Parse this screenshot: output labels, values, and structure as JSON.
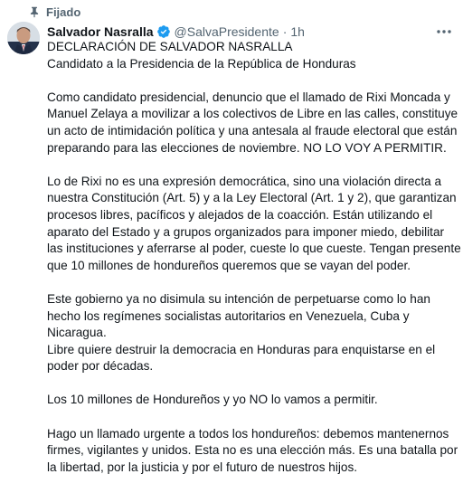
{
  "pinned": {
    "label": "Fijado",
    "icon": "pin-icon"
  },
  "author": {
    "display_name": "Salvador Nasralla",
    "handle": "@SalvaPresidente",
    "separator": "·",
    "time": "1h",
    "verified_icon": "verified-badge-icon",
    "verified_color": "#1d9bf0"
  },
  "more_icon": "more-horizontal-icon",
  "body": {
    "title_lines": [
      "DECLARACIÓN DE SALVADOR NASRALLA",
      "Candidato a la Presidencia de la República de Honduras"
    ],
    "paragraph1": [
      "Como candidato presidencial, denuncio que el llamado de Rixi Moncada y",
      "Manuel Zelaya a movilizar a los colectivos de Libre en las calles, constituye",
      "un acto de intimidación política y una antesala al fraude electoral que están",
      "preparando para las elecciones de noviembre. NO LO VOY A PERMITIR."
    ],
    "paragraph2": [
      "Lo de Rixi no es una expresión democrática, sino una violación directa a",
      "nuestra Constitución (Art. 5) y a la Ley Electoral (Art. 1 y 2), que garantizan",
      "procesos libres, pacíficos y alejados de la coacción. Están utilizando el",
      "aparato del Estado y a grupos organizados para imponer miedo, debilitar",
      "las instituciones y aferrarse al poder, cueste lo que cueste. Tengan presente",
      "que 10 millones de hondureños queremos que se vayan del poder."
    ],
    "paragraph3": [
      "Este gobierno ya no disimula su intención de perpetuarse como lo han",
      "hecho los regímenes socialistas autoritarios en Venezuela, Cuba  y",
      "Nicaragua.",
      "Libre quiere destruir la democracia en Honduras para enquistarse en el",
      "poder por décadas."
    ],
    "paragraph4": [
      "Los 10 millones de Hondureños y yo NO lo vamos a permitir."
    ],
    "paragraph5": [
      "Hago un llamado urgente a todos los hondureños: debemos mantenernos",
      "firmes, vigilantes y unidos. Esta no es una elección más. Es una batalla por",
      "la libertad, por la justicia y por el futuro de nuestros hijos."
    ]
  }
}
